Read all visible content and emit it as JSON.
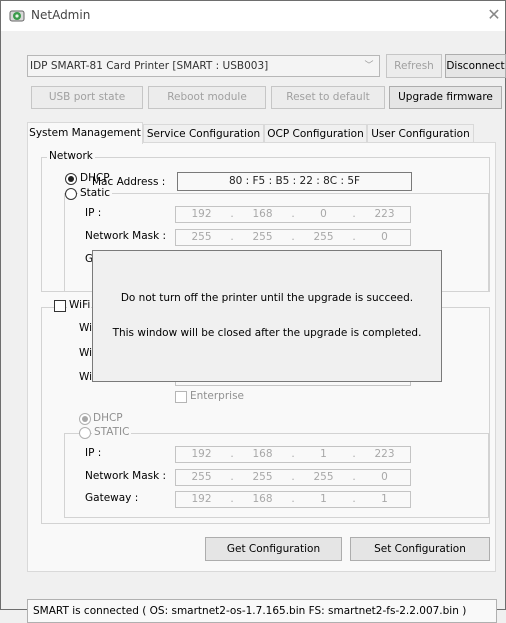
{
  "window": {
    "title": "NetAdmin",
    "close_glyph": "✕"
  },
  "toolbar": {
    "printer_select": "IDP SMART-81 Card Printer  [SMART : USB003]",
    "refresh_label": "Refresh",
    "disconnect_label": "Disconnect",
    "usb_port_state_label": "USB port state",
    "reboot_module_label": "Reboot module",
    "reset_default_label": "Reset to default",
    "upgrade_firmware_label": "Upgrade firmware"
  },
  "tabs": [
    {
      "label": "System Management",
      "active": true
    },
    {
      "label": "Service Configuration",
      "active": false
    },
    {
      "label": "OCP Configuration",
      "active": false
    },
    {
      "label": "User Configuration",
      "active": false
    }
  ],
  "network": {
    "legend": "Network",
    "dhcp_label": "DHCP",
    "static_label": "Static",
    "mac_label": "Mac Address :",
    "mac_value": "80 : F5 : B5 : 22 : 8C : 5F",
    "ip_label": "IP :",
    "ip": [
      "192",
      "168",
      "0",
      "223"
    ],
    "mask_label": "Network Mask :",
    "mask": [
      "255",
      "255",
      "255",
      "0"
    ],
    "gateway_label_fragment": "G"
  },
  "wifi": {
    "checkbox_label_fragment": "WiFi",
    "row1_fragment": "Wif",
    "row2_fragment": "WiF",
    "row3_fragment": "Wi",
    "enterprise_label": "Enterprise",
    "dhcp_label": "DHCP",
    "static_label": "STATIC",
    "ip_label": "IP :",
    "ip": [
      "192",
      "168",
      "1",
      "223"
    ],
    "mask_label": "Network Mask :",
    "mask": [
      "255",
      "255",
      "255",
      "0"
    ],
    "gateway_label": "Gateway :",
    "gateway": [
      "192",
      "168",
      "1",
      "1"
    ]
  },
  "actions": {
    "get_config_label": "Get Configuration",
    "set_config_label": "Set Configuration"
  },
  "popup": {
    "line1": "Do not turn off the printer until the upgrade is succeed.",
    "line2": "This window will be closed after the upgrade is completed."
  },
  "status": {
    "text": "SMART is connected ( OS: smartnet2-os-1.7.165.bin  FS: smartnet2-fs-2.2.007.bin )"
  },
  "colors": {
    "accent_green": "#2e8b3e",
    "disabled_text": "#a0a0a0"
  }
}
